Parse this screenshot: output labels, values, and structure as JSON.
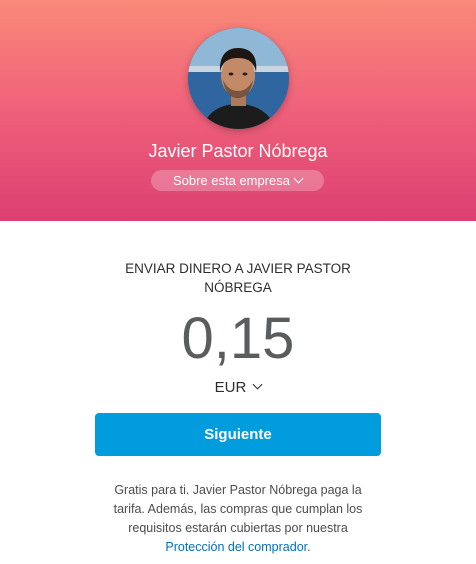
{
  "header": {
    "merchant_name": "Javier Pastor Nóbrega",
    "about_label": "Sobre esta empresa"
  },
  "payment": {
    "send_title": "ENVIAR DINERO A JAVIER PASTOR NÓBREGA",
    "amount": "0,15",
    "currency": "EUR",
    "next_label": "Siguiente"
  },
  "footer": {
    "note_text": "Gratis para ti. Javier Pastor Nóbrega paga la tarifa. Además, las compras que cumplan los requisitos estarán cubiertas por nuestra",
    "link_text": "Protección del comprador",
    "link_suffix": "."
  },
  "colors": {
    "gradient_top": "#f98a78",
    "gradient_bottom": "#dc3f72",
    "primary_button": "#009cde",
    "link": "#0070ba"
  },
  "icons": [
    "chevron-down-icon"
  ]
}
